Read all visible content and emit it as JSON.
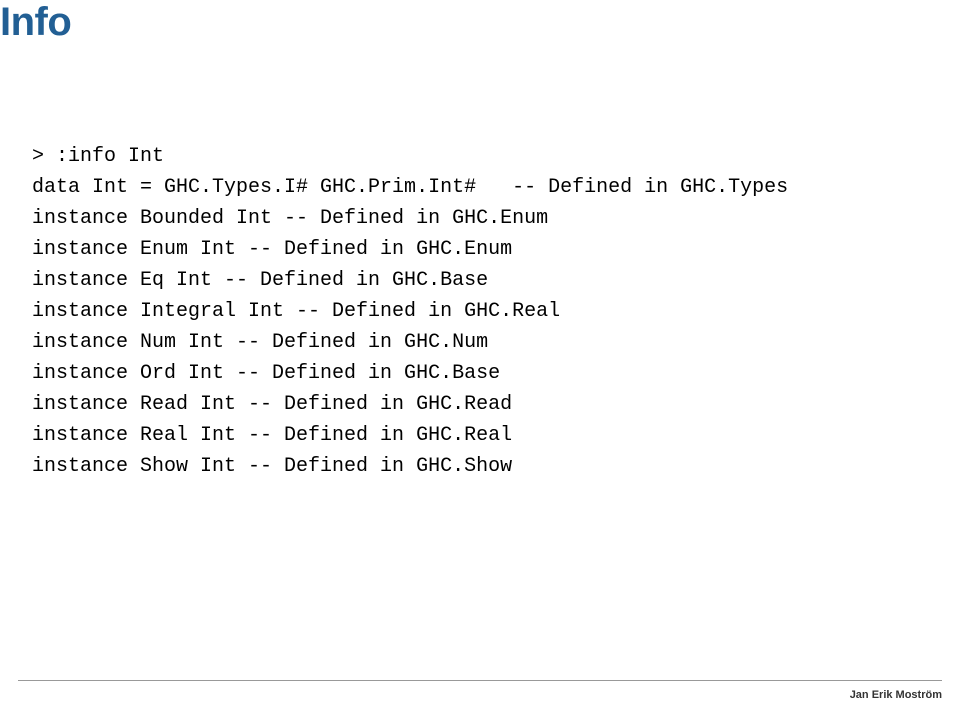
{
  "slide": {
    "title": "Info",
    "code_lines": [
      "> :info Int",
      "data Int = GHC.Types.I# GHC.Prim.Int# \t-- Defined in GHC.Types",
      "instance Bounded Int -- Defined in GHC.Enum",
      "instance Enum Int -- Defined in GHC.Enum",
      "instance Eq Int -- Defined in GHC.Base",
      "instance Integral Int -- Defined in GHC.Real",
      "instance Num Int -- Defined in GHC.Num",
      "instance Ord Int -- Defined in GHC.Base",
      "instance Read Int -- Defined in GHC.Read",
      "instance Real Int -- Defined in GHC.Real",
      "instance Show Int -- Defined in GHC.Show"
    ],
    "footer": "Jan Erik Moström"
  }
}
